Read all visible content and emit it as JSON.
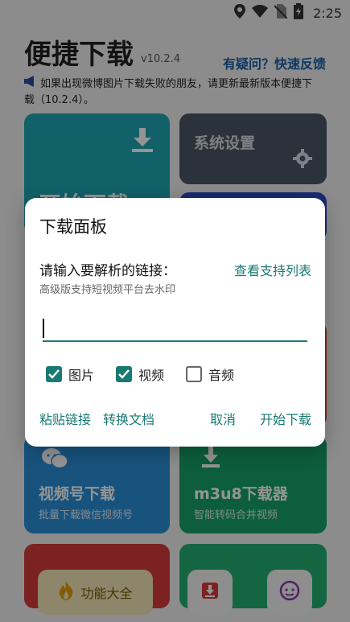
{
  "status_bar": {
    "time": "2:25",
    "icons": [
      "location-icon",
      "wifi-icon",
      "no-sim-icon",
      "battery-charging-icon"
    ]
  },
  "app": {
    "title": "便捷下载",
    "version": "v10.2.4",
    "help_link": "有疑问？快速反馈",
    "notice": "如果出现微博图片下载失败的朋友，请更新最新版本便捷下载（10.2.4）。"
  },
  "cards": {
    "start": {
      "title": "开始下载"
    },
    "settings": {
      "title": "系统设置"
    },
    "wechat_video": {
      "title": "视频号下载",
      "subtitle": "批量下载微信视频号"
    },
    "m3u8": {
      "title": "m3u8下载器",
      "subtitle": "智能转码合并视频"
    }
  },
  "bottom_nav": {
    "main_label": "功能大全"
  },
  "dialog": {
    "title": "下载面板",
    "prompt": "请输入要解析的链接：",
    "support_list": "查看支持列表",
    "hint": "高级版支持短视频平台去水印",
    "input_value": "",
    "input_placeholder": "",
    "options": [
      {
        "label": "图片",
        "checked": true
      },
      {
        "label": "视频",
        "checked": true
      },
      {
        "label": "音频",
        "checked": false
      }
    ],
    "buttons": {
      "paste": "粘贴链接",
      "convert": "转换文档",
      "cancel": "取消",
      "start": "开始下载"
    }
  },
  "colors": {
    "accent": "#1a7a73",
    "card_teal": "#1fa8b3",
    "card_gray": "#4d5666",
    "card_blue": "#2a8fd8",
    "card_green": "#16a26a",
    "card_red": "#d63b3b"
  }
}
